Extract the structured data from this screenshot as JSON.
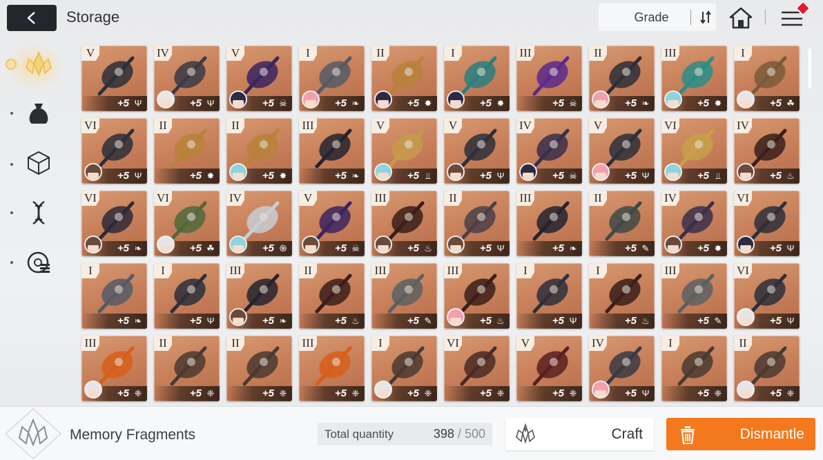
{
  "header": {
    "title": "Storage",
    "sort_label": "Grade"
  },
  "sidebar": {
    "items": [
      {
        "name": "memory-fragments",
        "icon": "crystal-icon",
        "active": true
      },
      {
        "name": "bag",
        "icon": "pouch-icon",
        "active": false
      },
      {
        "name": "materials",
        "icon": "cube-icon",
        "active": false
      },
      {
        "name": "gene",
        "icon": "dna-icon",
        "active": false
      },
      {
        "name": "chips",
        "icon": "disc-icon",
        "active": false
      }
    ]
  },
  "items": [
    {
      "grade": "V",
      "level": "+5",
      "type": "trident",
      "avatar": "none",
      "weapon": "claw"
    },
    {
      "grade": "IV",
      "level": "+5",
      "type": "trident",
      "avatar": "white",
      "weapon": "thorn"
    },
    {
      "grade": "V",
      "level": "+5",
      "type": "skull",
      "avatar": "dark",
      "weapon": "hammer"
    },
    {
      "grade": "I",
      "level": "+5",
      "type": "wing",
      "avatar": "pink",
      "weapon": "dagger"
    },
    {
      "grade": "II",
      "level": "+5",
      "type": "bug",
      "avatar": "dark",
      "weapon": "staff"
    },
    {
      "grade": "I",
      "level": "+5",
      "type": "bug",
      "avatar": "dark",
      "weapon": "orb"
    },
    {
      "grade": "III",
      "level": "+5",
      "type": "skull",
      "avatar": "none",
      "weapon": "purple"
    },
    {
      "grade": "II",
      "level": "+5",
      "type": "wing",
      "avatar": "pink",
      "weapon": "claw"
    },
    {
      "grade": "III",
      "level": "+5",
      "type": "bug",
      "avatar": "teal",
      "weapon": "globe"
    },
    {
      "grade": "I",
      "level": "+5",
      "type": "leaf",
      "avatar": "white",
      "weapon": "cannon"
    },
    {
      "grade": "VI",
      "level": "+5",
      "type": "trident",
      "avatar": "brown",
      "weapon": "claw"
    },
    {
      "grade": "II",
      "level": "+5",
      "type": "bug",
      "avatar": "none",
      "weapon": "staff"
    },
    {
      "grade": "II",
      "level": "+5",
      "type": "bug",
      "avatar": "teal",
      "weapon": "staff"
    },
    {
      "grade": "III",
      "level": "+5",
      "type": "wing",
      "avatar": "none",
      "weapon": "dark"
    },
    {
      "grade": "V",
      "level": "+5",
      "type": "fork",
      "avatar": "teal",
      "weapon": "lantern"
    },
    {
      "grade": "V",
      "level": "+5",
      "type": "trident",
      "avatar": "brown",
      "weapon": "claw"
    },
    {
      "grade": "IV",
      "level": "+5",
      "type": "skull",
      "avatar": "dark",
      "weapon": "chain"
    },
    {
      "grade": "V",
      "level": "+5",
      "type": "trident",
      "avatar": "pink",
      "weapon": "claw"
    },
    {
      "grade": "VI",
      "level": "+5",
      "type": "fork",
      "avatar": "teal",
      "weapon": "gold"
    },
    {
      "grade": "IV",
      "level": "+5",
      "type": "fire",
      "avatar": "brown",
      "weapon": "flame"
    },
    {
      "grade": "VI",
      "level": "+5",
      "type": "wing",
      "avatar": "brown",
      "weapon": "feather"
    },
    {
      "grade": "VI",
      "level": "+5",
      "type": "leaf",
      "avatar": "white",
      "weapon": "wreath"
    },
    {
      "grade": "IV",
      "level": "+5",
      "type": "swirl",
      "avatar": "teal",
      "weapon": "vial"
    },
    {
      "grade": "V",
      "level": "+5",
      "type": "skull",
      "avatar": "brown",
      "weapon": "hammer"
    },
    {
      "grade": "III",
      "level": "+5",
      "type": "fire",
      "avatar": "brown",
      "weapon": "flame"
    },
    {
      "grade": "II",
      "level": "+5",
      "type": "trident",
      "avatar": "brown",
      "weapon": "mace"
    },
    {
      "grade": "III",
      "level": "+5",
      "type": "wing",
      "avatar": "none",
      "weapon": "dark"
    },
    {
      "grade": "II",
      "level": "+5",
      "type": "pen",
      "avatar": "none",
      "weapon": "key"
    },
    {
      "grade": "IV",
      "level": "+5",
      "type": "bug",
      "avatar": "brown",
      "weapon": "chain"
    },
    {
      "grade": "VI",
      "level": "+5",
      "type": "trident",
      "avatar": "dark",
      "weapon": "claw"
    },
    {
      "grade": "I",
      "level": "+5",
      "type": "wing",
      "avatar": "none",
      "weapon": "dagger"
    },
    {
      "grade": "I",
      "level": "+5",
      "type": "trident",
      "avatar": "none",
      "weapon": "claw"
    },
    {
      "grade": "III",
      "level": "+5",
      "type": "wing",
      "avatar": "brown",
      "weapon": "dark"
    },
    {
      "grade": "II",
      "level": "+5",
      "type": "fire",
      "avatar": "none",
      "weapon": "flame"
    },
    {
      "grade": "III",
      "level": "+5",
      "type": "pen",
      "avatar": "none",
      "weapon": "turtle"
    },
    {
      "grade": "III",
      "level": "+5",
      "type": "fire",
      "avatar": "pink",
      "weapon": "flame"
    },
    {
      "grade": "I",
      "level": "+5",
      "type": "trident",
      "avatar": "none",
      "weapon": "claw"
    },
    {
      "grade": "I",
      "level": "+5",
      "type": "fire",
      "avatar": "none",
      "weapon": "flame"
    },
    {
      "grade": "III",
      "level": "+5",
      "type": "pen",
      "avatar": "none",
      "weapon": "turtle"
    },
    {
      "grade": "VI",
      "level": "+5",
      "type": "trident",
      "avatar": "white",
      "weapon": "claw"
    },
    {
      "grade": "III",
      "level": "+5",
      "type": "shield",
      "avatar": "white",
      "weapon": "pumpkin"
    },
    {
      "grade": "II",
      "level": "+5",
      "type": "shield",
      "avatar": "none",
      "weapon": "axe"
    },
    {
      "grade": "II",
      "level": "+5",
      "type": "shield",
      "avatar": "none",
      "weapon": "axe"
    },
    {
      "grade": "III",
      "level": "+5",
      "type": "shield",
      "avatar": "none",
      "weapon": "pumpkin"
    },
    {
      "grade": "I",
      "level": "+5",
      "type": "shield",
      "avatar": "white",
      "weapon": "axe"
    },
    {
      "grade": "VI",
      "level": "+5",
      "type": "shield",
      "avatar": "none",
      "weapon": "crossbow"
    },
    {
      "grade": "V",
      "level": "+5",
      "type": "shield",
      "avatar": "none",
      "weapon": "brazier"
    },
    {
      "grade": "IV",
      "level": "+5",
      "type": "trident",
      "avatar": "pink",
      "weapon": "thorn"
    },
    {
      "grade": "I",
      "level": "+5",
      "type": "shield",
      "avatar": "none",
      "weapon": "axe"
    },
    {
      "grade": "II",
      "level": "+5",
      "type": "shield",
      "avatar": "white",
      "weapon": "axe"
    }
  ],
  "bottom": {
    "category_label": "Memory Fragments",
    "total_label": "Total quantity",
    "total_value": "398",
    "total_sep": " / ",
    "total_max": "500",
    "craft_label": "Craft",
    "dismantle_label": "Dismantle"
  },
  "colors": {
    "accent": "#f4781d",
    "card": "#c9825c",
    "header_dark": "#23262b",
    "badge": "#e3192f"
  }
}
